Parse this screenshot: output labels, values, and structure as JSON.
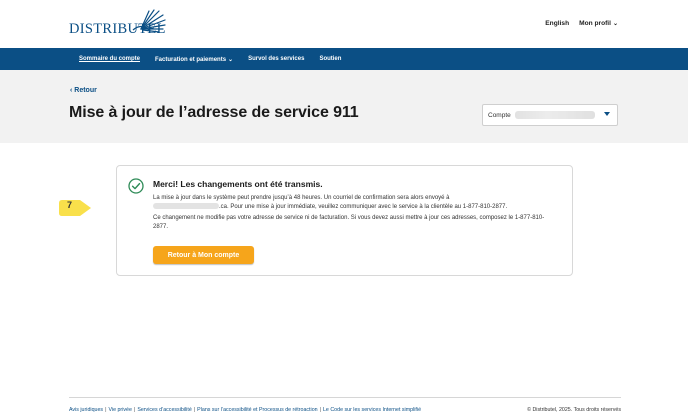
{
  "header": {
    "logo_text": "DISTRIBUTEL",
    "language_link": "English",
    "profile_menu": "Mon profil"
  },
  "nav": {
    "items": [
      {
        "label": "Sommaire du compte",
        "active": true
      },
      {
        "label": "Facturation et paiements",
        "has_dropdown": true
      },
      {
        "label": "Survol des services"
      },
      {
        "label": "Soutien"
      }
    ]
  },
  "page": {
    "back_label": "Retour",
    "title": "Mise à jour de l’adresse de service 911",
    "account_label": "Compte"
  },
  "confirmation": {
    "title": "Merci! Les changements ont été transmis.",
    "p1_before_email": "La mise à jour dans le système peut prendre jusqu’à 48 heures. Un courriel de confirmation sera alors envoyé à",
    "p1_after_email": ".ca. Pour une mise à jour immédiate, veuillez communiquer avec le service à la clientèle au 1-877-810-2877.",
    "p2": "Ce changement ne modifie pas votre adresse de service ni de facturation. Si vous devez aussi mettre à jour ces adresses, composez le 1-877-810-2877.",
    "button_label": "Retour à Mon compte"
  },
  "step_badge": {
    "number": "7",
    "color": "#f9e04b"
  },
  "footer": {
    "links": [
      "Avis juridiques",
      "Vie privée",
      "Services d’accessibilité",
      "Plans sur l’accessibilité et Processus de rétroaction",
      "Le Code sur les services Internet simplifié"
    ],
    "copyright": "© Distributel, 2025. Tous droits réservés"
  },
  "colors": {
    "brand_blue": "#0b4f85",
    "button_orange": "#f6a51b",
    "success_green": "#2e8b57"
  },
  "icons": [
    "chevron-down-icon",
    "chevron-left-icon",
    "check-circle-icon",
    "logo-burst-icon"
  ]
}
